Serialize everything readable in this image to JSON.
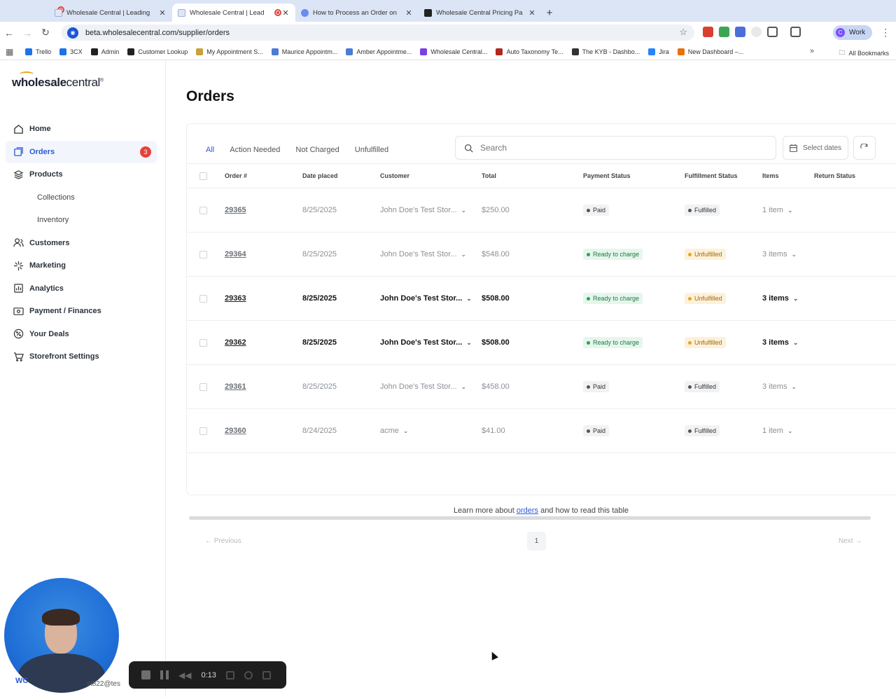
{
  "browser": {
    "tabs": [
      {
        "label": "Wholesale Central | Leading",
        "active": false
      },
      {
        "label": "Wholesale Central | Lead",
        "active": true
      },
      {
        "label": "How to Process an Order on",
        "active": false
      },
      {
        "label": "Wholesale Central Pricing Pa",
        "active": false
      }
    ],
    "url": "beta.wholesalecentral.com/supplier/orders",
    "profile": "Work",
    "profile_initial": "C",
    "bookmarks": [
      "Trello",
      "3CX",
      "Admin",
      "Customer Lookup",
      "My Appointment S...",
      "Maurice Appointm...",
      "Amber Appointme...",
      "Wholesale Central...",
      "Auto Taxonomy Te...",
      "The KYB - Dashbo...",
      "Jira",
      "New Dashboard –..."
    ],
    "all_bookmarks": "All Bookmarks"
  },
  "sidebar": {
    "logo_bold": "wholesale",
    "logo_light": "central",
    "items": [
      {
        "label": "Home",
        "icon": "home-icon"
      },
      {
        "label": "Orders",
        "icon": "orders-icon",
        "badge": "3",
        "active": true
      },
      {
        "label": "Products",
        "icon": "layers-icon"
      },
      {
        "label": "Collections",
        "sub": true
      },
      {
        "label": "Inventory",
        "sub": true
      },
      {
        "label": "Customers",
        "icon": "users-icon"
      },
      {
        "label": "Marketing",
        "icon": "sparkle-icon"
      },
      {
        "label": "Analytics",
        "icon": "chart-icon"
      },
      {
        "label": "Payment / Finances",
        "icon": "payment-icon"
      },
      {
        "label": "Your Deals",
        "icon": "percent-icon"
      },
      {
        "label": "Storefront Settings",
        "icon": "cart-icon"
      }
    ],
    "user_email_fragment": "st822@tes",
    "user_wc": "WC"
  },
  "page": {
    "title": "Orders",
    "filter_tabs": [
      "All",
      "Action Needed",
      "Not Charged",
      "Unfulfilled"
    ],
    "search_placeholder": "Search",
    "select_dates": "Select dates",
    "columns": [
      "Order #",
      "Date placed",
      "Customer",
      "Total",
      "Payment Status",
      "Fulfillment Status",
      "Items",
      "Return Status"
    ],
    "rows": [
      {
        "order": "29365",
        "date": "8/25/2025",
        "customer": "John Doe's Test Stor...",
        "total": "$250.00",
        "payment": "Paid",
        "payment_kind": "paid",
        "fulfillment": "Fulfilled",
        "fulfillment_kind": "ful",
        "items": "1 item",
        "bold": false
      },
      {
        "order": "29364",
        "date": "8/25/2025",
        "customer": "John Doe's Test Stor...",
        "total": "$548.00",
        "payment": "Ready to charge",
        "payment_kind": "ready",
        "fulfillment": "Unfulfilled",
        "fulfillment_kind": "unf",
        "items": "3 items",
        "bold": false
      },
      {
        "order": "29363",
        "date": "8/25/2025",
        "customer": "John Doe's Test Stor...",
        "total": "$508.00",
        "payment": "Ready to charge",
        "payment_kind": "ready",
        "fulfillment": "Unfulfilled",
        "fulfillment_kind": "unf",
        "items": "3 items",
        "bold": true
      },
      {
        "order": "29362",
        "date": "8/25/2025",
        "customer": "John Doe's Test Stor...",
        "total": "$508.00",
        "payment": "Ready to charge",
        "payment_kind": "ready",
        "fulfillment": "Unfulfilled",
        "fulfillment_kind": "unf",
        "items": "3 items",
        "bold": true
      },
      {
        "order": "29361",
        "date": "8/25/2025",
        "customer": "John Doe's Test Stor...",
        "total": "$458.00",
        "payment": "Paid",
        "payment_kind": "paid",
        "fulfillment": "Fulfilled",
        "fulfillment_kind": "ful",
        "items": "3 items",
        "bold": false
      },
      {
        "order": "29360",
        "date": "8/24/2025",
        "customer": "acme",
        "total": "$41.00",
        "payment": "Paid",
        "payment_kind": "paid",
        "fulfillment": "Fulfilled",
        "fulfillment_kind": "ful",
        "items": "1 item",
        "bold": false
      }
    ],
    "pager": {
      "previous": "Previous",
      "page": "1",
      "next": "Next"
    },
    "learn_prefix": "Learn more about ",
    "learn_link": "orders",
    "learn_suffix": " and how to read this table"
  },
  "recorder": {
    "time": "0:13"
  },
  "colors": {
    "accent": "#2d5bd0",
    "badge": "#e5433a",
    "ready_bg": "#e6f6ec",
    "unfulfilled_bg": "#fdf1d9"
  }
}
